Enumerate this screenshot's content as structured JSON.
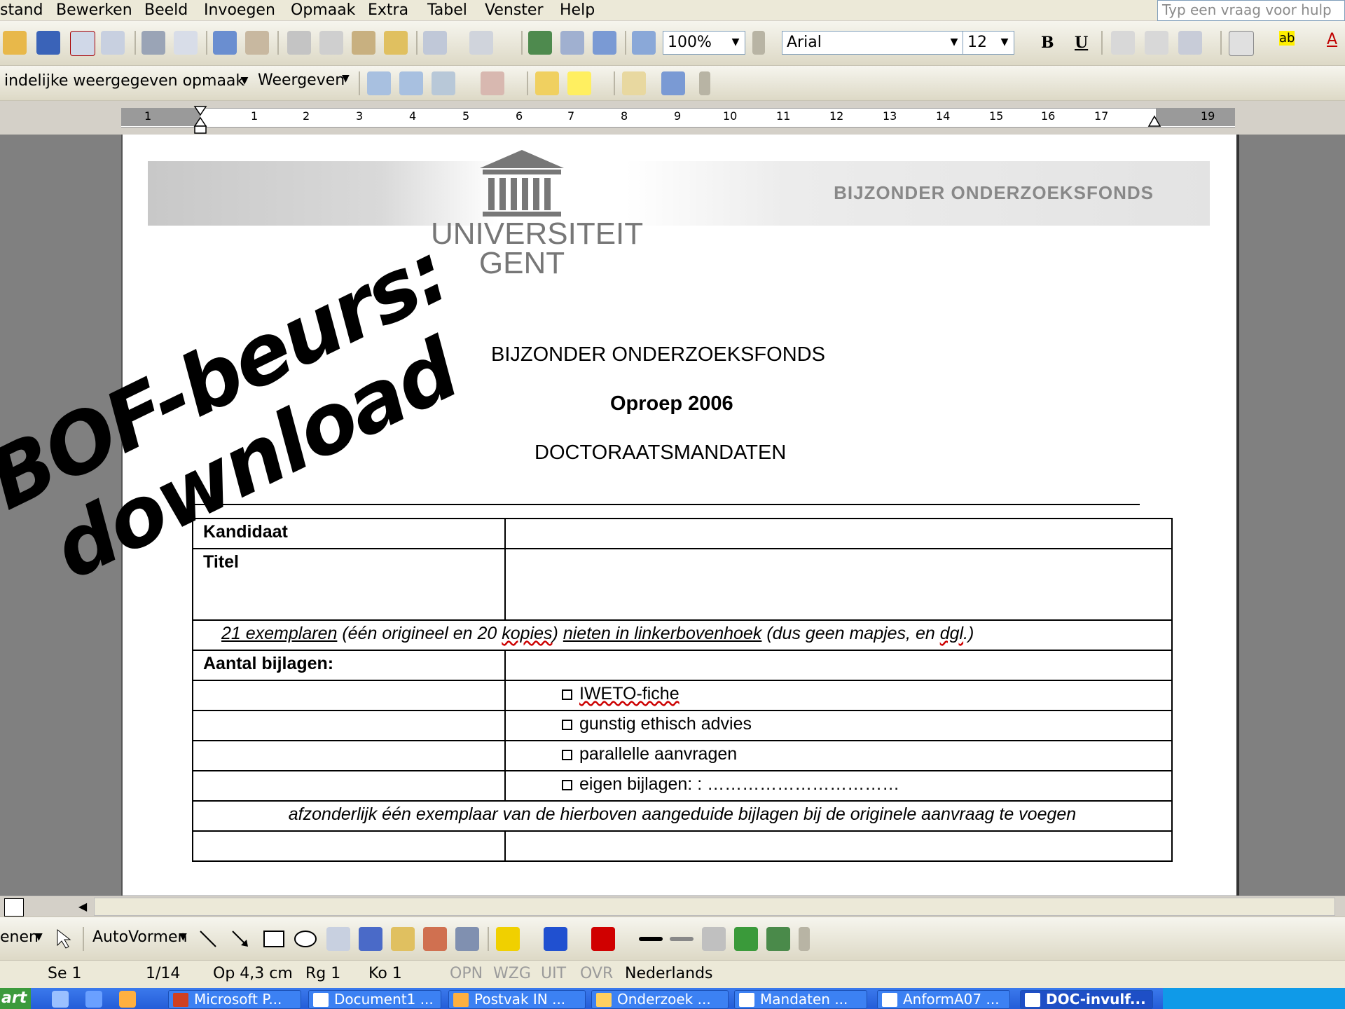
{
  "menu": {
    "items": [
      "stand",
      "Bewerken",
      "Beeld",
      "Invoegen",
      "Opmaak",
      "Extra",
      "Tabel",
      "Venster",
      "Help"
    ],
    "help_placeholder": "Typ een vraag voor hulp"
  },
  "toolbar": {
    "zoom": "100%",
    "font": "Arial",
    "font_size": "12",
    "bold": "B",
    "underline": "U",
    "text_color_label": "A",
    "highlight_label": "ab",
    "style_box": "indelijke weergegeven opmaak",
    "view_label": "Weergeven"
  },
  "ruler": {
    "numbers": [
      "1",
      "1",
      "2",
      "3",
      "4",
      "5",
      "6",
      "7",
      "8",
      "9",
      "10",
      "11",
      "12",
      "13",
      "14",
      "15",
      "16",
      "17",
      "19"
    ]
  },
  "page": {
    "header_band_text": "BIJZONDER ONDERZOEKSFONDS",
    "logo_line1": "UNIVERSITEIT",
    "logo_line2": "GENT",
    "title1": "BIJZONDER ONDERZOEKSFONDS",
    "title2": "Oproep 2006",
    "title3": "DOCTORAATSMANDATEN"
  },
  "form": {
    "kandidaat": "Kandidaat",
    "titel": "Titel",
    "exemplaren_a": "21 exemplaren",
    "exemplaren_b": " (één origineel en 20 ",
    "exemplaren_c": "kopies",
    "exemplaren_d": ") ",
    "exemplaren_e": "nieten in linkerbovenhoek",
    "exemplaren_f": " (dus geen mapjes, en ",
    "exemplaren_g": "dgl",
    "exemplaren_h": ".)",
    "aantal_bijlagen": "Aantal bijlagen:",
    "option1": "IWETO-fiche",
    "option2": "gunstig ethisch advies",
    "option3": "parallelle aanvragen",
    "option4": "eigen bijlagen: : ……………………………",
    "note": "afzonderlijk één exemplaar van de hierboven aangeduide bijlagen bij de originele aanvraag te voegen"
  },
  "overlay": {
    "line1": "BOF-beurs:",
    "line2": "download"
  },
  "drawing_toolbar": {
    "draw_label": "enen",
    "autoshapes_label": "AutoVormen"
  },
  "status": {
    "section": "Se 1",
    "pages": "1/14",
    "position": "Op 4,3 cm",
    "line": "Rg 1",
    "column": "Ko 1",
    "rec": "OPN",
    "trk": "WZG",
    "ext": "UIT",
    "ovr": "OVR",
    "language": "Nederlands"
  },
  "taskbar": {
    "start": "art",
    "items": [
      "Microsoft P...",
      "Document1 ...",
      "Postvak IN ...",
      "Onderzoek ...",
      "Mandaten ...",
      "AnformA07 ...",
      "DOC-invulf..."
    ]
  },
  "colors": {
    "menu_bg": "#ece9d8",
    "page_bg": "#ffffff",
    "workspace_bg": "#808080",
    "taskbar_bg": "#245dd8"
  }
}
